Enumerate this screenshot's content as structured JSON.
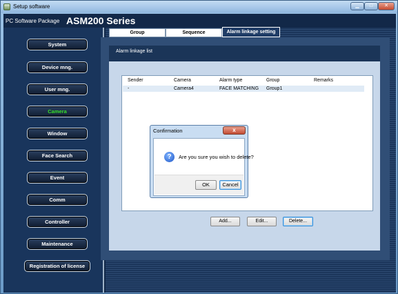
{
  "window": {
    "title": "Setup software"
  },
  "brand": {
    "prefix": "PC Software Package",
    "product": "ASM200 Series"
  },
  "sidebar": {
    "items": [
      {
        "label": "System"
      },
      {
        "label": "Device mng."
      },
      {
        "label": "User mng."
      },
      {
        "label": "Camera",
        "active": true
      },
      {
        "label": "Window"
      },
      {
        "label": "Face Search"
      },
      {
        "label": "Event"
      },
      {
        "label": "Comm"
      },
      {
        "label": "Controller"
      },
      {
        "label": "Maintenance"
      },
      {
        "label": "Registration of license"
      }
    ]
  },
  "tabs": [
    {
      "label": "Group"
    },
    {
      "label": "Sequence"
    },
    {
      "label": "Alarm linkage setting",
      "active": true
    }
  ],
  "list": {
    "title": "Alarm linkage list",
    "columns": [
      "Sender",
      "Camera",
      "Alarm type",
      "Group",
      "Remarks"
    ],
    "rows": [
      {
        "sender": "-",
        "camera": "Camera4",
        "alarm_type": "FACE MATCHING",
        "group": "Group1",
        "remarks": ""
      }
    ]
  },
  "actions": {
    "add": "Add...",
    "edit": "Edit...",
    "delete": "Delete..."
  },
  "dialog": {
    "title": "Confirmation",
    "close": "x",
    "message": "Are you sure you wish to delete?",
    "ok": "OK",
    "cancel": "Cancel"
  },
  "colors": {
    "sidebar_active_text": "#36e02a",
    "panel_bg": "#304e76",
    "inner_bg": "#c7d7ea"
  },
  "icons": {
    "dialog": "question-icon"
  }
}
